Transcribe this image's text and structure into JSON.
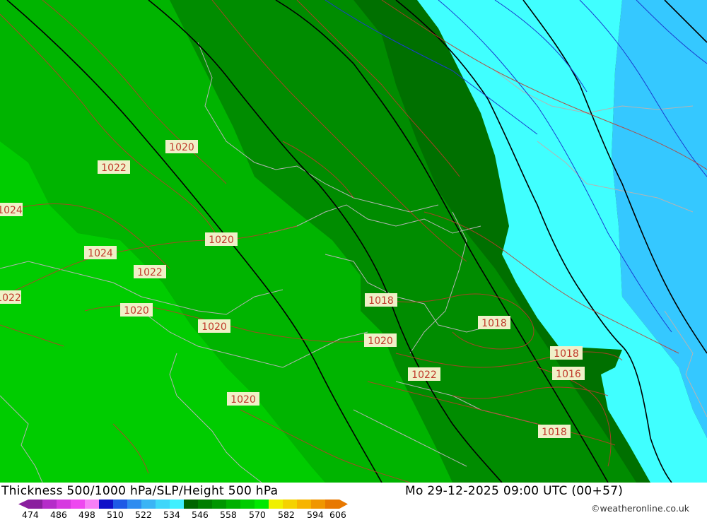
{
  "title": "Thickness 500/1000 hPa/SLP/Height 500 hPa",
  "datetime": "Mo 29-12-2025 09:00 UTC (00+57)",
  "credit": "©weatheronline.co.uk",
  "legend": {
    "ticks": [
      "474",
      "486",
      "498",
      "510",
      "522",
      "534",
      "546",
      "558",
      "570",
      "582",
      "594",
      "606"
    ],
    "colors": [
      "#8a1f9e",
      "#b52cc9",
      "#d63ae0",
      "#ee47f0",
      "#f77ff7",
      "#1010c8",
      "#1e5ae6",
      "#2f8cf0",
      "#3ab4f5",
      "#3fd6fa",
      "#40f0ff",
      "#006400",
      "#007e00",
      "#009600",
      "#00b000",
      "#00cc00",
      "#00e800",
      "#f0f000",
      "#f5d200",
      "#f7b400",
      "#f09600",
      "#e87800"
    ]
  },
  "slp_labels": [
    "1020",
    "1022",
    "1024",
    "1020",
    "1024",
    "1022",
    "1022",
    "1020",
    "1020",
    "1018",
    "1020",
    "1018",
    "1018",
    "1022",
    "1016",
    "1020",
    "1018"
  ],
  "colors": {
    "thickness_546": "#00b400",
    "thickness_552": "#00a000",
    "thickness_558": "#00cc00",
    "thickness_540": "#008c00",
    "thickness_534": "#007400",
    "thickness_528": "#40ffff",
    "thickness_522": "#35c8ff",
    "isobar": "#c0392b",
    "label_bg": "#f0f0c8"
  }
}
